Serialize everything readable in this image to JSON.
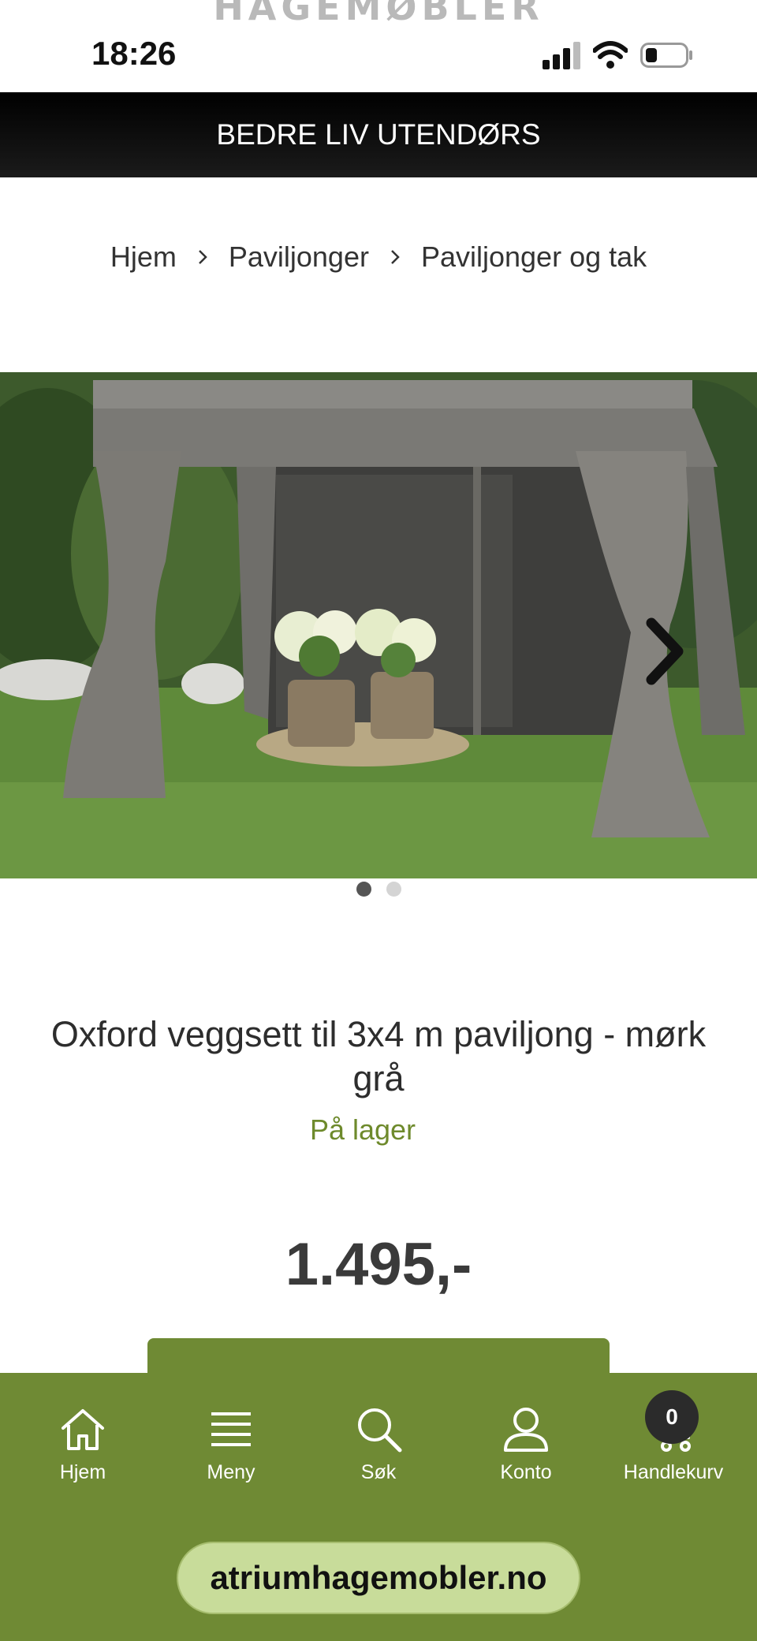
{
  "status_bar": {
    "time": "18:26",
    "logo_text": "HAGEMØBLER",
    "icons": [
      "signal-icon",
      "wifi-icon",
      "battery-icon"
    ]
  },
  "promo": {
    "text": "BEDRE LIV UTENDØRS"
  },
  "breadcrumb": {
    "items": [
      "Hjem",
      "Paviljonger",
      "Paviljonger og tak"
    ]
  },
  "gallery": {
    "slide_count": 2,
    "active_slide": 1,
    "next_icon": "chevron-right-icon"
  },
  "product": {
    "title": "Oxford veggsett til 3x4 m paviljong - mørk grå",
    "stock": "På lager",
    "price": "1.495,-"
  },
  "bottom_nav": {
    "items": [
      {
        "label": "Hjem",
        "icon": "home-icon"
      },
      {
        "label": "Meny",
        "icon": "menu-icon"
      },
      {
        "label": "Søk",
        "icon": "search-icon"
      },
      {
        "label": "Konto",
        "icon": "user-icon"
      },
      {
        "label": "Handlekurv",
        "icon": "cart-icon"
      }
    ],
    "cart_count": "0"
  },
  "browser": {
    "url": "atriumhagemobler.no"
  },
  "colors": {
    "brand_green": "#6f8a34",
    "stock_green": "#6e8a2c",
    "url_pill": "#c8dc9a"
  }
}
